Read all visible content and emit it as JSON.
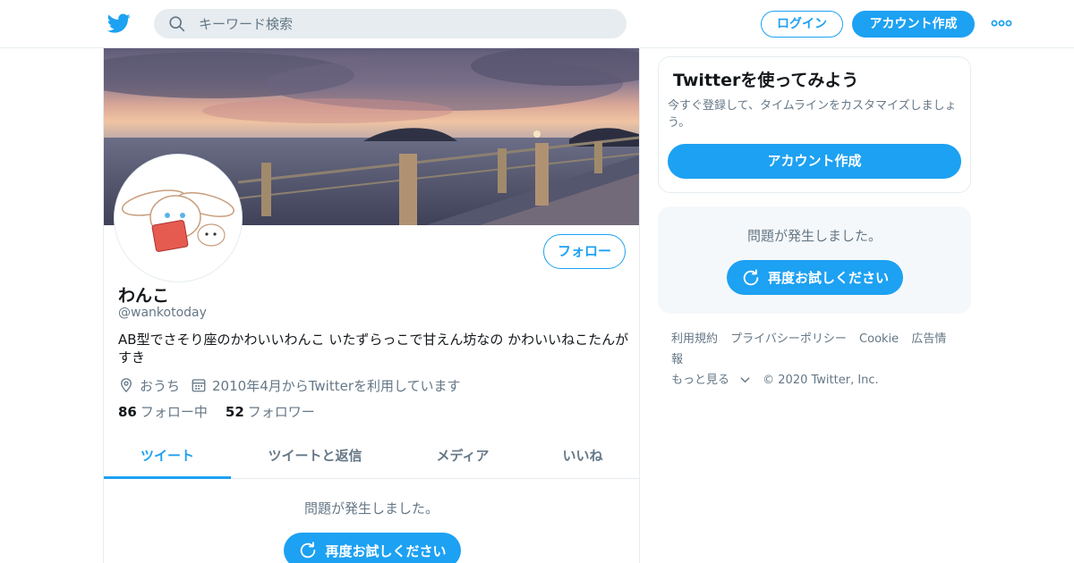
{
  "header": {
    "logo_icon": "twitter-bird-icon",
    "search": {
      "placeholder": "キーワード検索",
      "icon": "search-icon"
    },
    "login_label": "ログイン",
    "signup_label": "アカウント作成",
    "more_icon": "more-dots-icon"
  },
  "profile": {
    "display_name": "わんこ",
    "handle": "@wankotoday",
    "bio": "AB型でさそり座のかわいいわんこ いたずらっこで甘えん坊なの かわいいねこたんがすき",
    "location": "おうち",
    "joined": "2010年4月からTwitterを利用しています",
    "following_count": "86",
    "following_label": "フォロー中",
    "followers_count": "52",
    "followers_label": "フォロワー",
    "follow_button": "フォロー"
  },
  "tabs": [
    {
      "label": "ツイート",
      "active": true
    },
    {
      "label": "ツイートと返信",
      "active": false
    },
    {
      "label": "メディア",
      "active": false
    },
    {
      "label": "いいね",
      "active": false
    }
  ],
  "main_error": {
    "message": "問題が発生しました。",
    "retry_label": "再度お試しください"
  },
  "sidebar": {
    "signup_card": {
      "title": "Twitterを使ってみよう",
      "description": "今すぐ登録して、タイムラインをカスタマイズしましょう。",
      "button": "アカウント作成"
    },
    "error_card": {
      "message": "問題が発生しました。",
      "retry_label": "再度お試しください"
    }
  },
  "footer": {
    "links": [
      "利用規約",
      "プライバシーポリシー",
      "Cookie",
      "広告情報"
    ],
    "more": "もっと見る",
    "copyright": "© 2020 Twitter, Inc."
  },
  "colors": {
    "accent": "#1da1f2",
    "secondary_text": "#657786",
    "border": "#e6ecf0"
  }
}
